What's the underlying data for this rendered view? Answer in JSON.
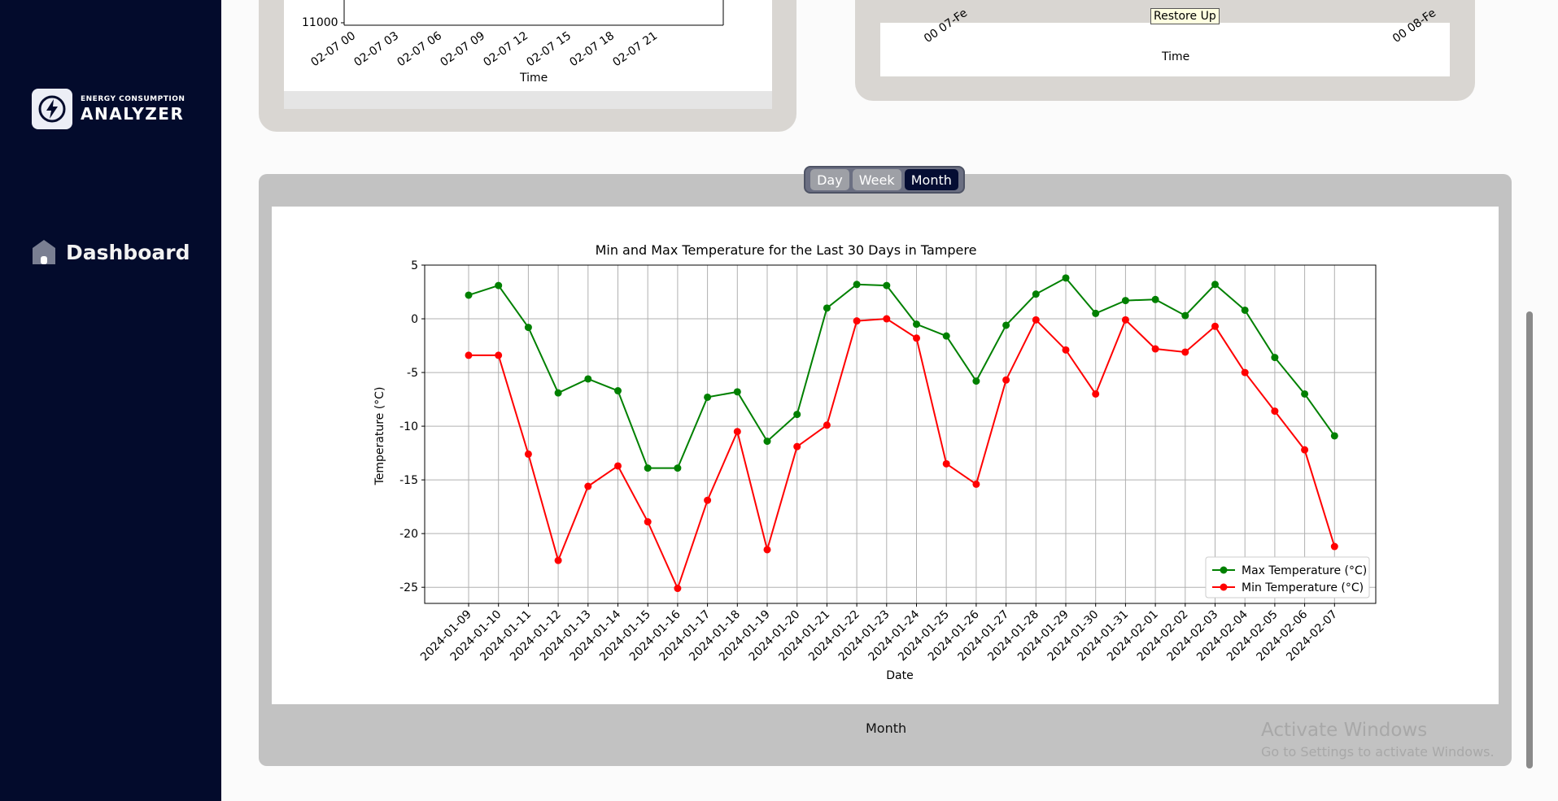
{
  "sidebar": {
    "logo_small": "ENERGY CONSUMPTION",
    "logo_big": "ANALYZER",
    "nav_items": [
      {
        "label": "Dashboard"
      }
    ]
  },
  "top_left_chart": {
    "y_tick": "11000",
    "x_ticks": [
      "02-07 00",
      "02-07 03",
      "02-07 06",
      "02-07 09",
      "02-07 12",
      "02-07 15",
      "02-07 18",
      "02-07 21"
    ],
    "xlabel": "Time"
  },
  "top_right_chart": {
    "xlabel": "Time",
    "tick_left": "07-Fe",
    "tick_left_top": "00",
    "tick_right": "08-Fe",
    "tick_right_top": "00"
  },
  "tooltip": "Restore Up",
  "range_selector": {
    "options": [
      "Day",
      "Week",
      "Month"
    ],
    "selected": "Month"
  },
  "footer_label": "Month",
  "watermark": {
    "line1": "Activate Windows",
    "line2": "Go to Settings to activate Windows."
  },
  "colors": {
    "max": "#008000",
    "min": "#ff0000",
    "sidebar": "#030b2c"
  },
  "chart_data": {
    "type": "line",
    "title": "Min and Max Temperature for the Last 30 Days in Tampere",
    "xlabel": "Date",
    "ylabel": "Temperature (°C)",
    "ylim": [
      -26.5,
      5
    ],
    "yticks": [
      5,
      0,
      -5,
      -10,
      -15,
      -20,
      -25
    ],
    "grid": true,
    "legend": "lower-right",
    "x": [
      "2024-01-09",
      "2024-01-10",
      "2024-01-11",
      "2024-01-12",
      "2024-01-13",
      "2024-01-14",
      "2024-01-15",
      "2024-01-16",
      "2024-01-17",
      "2024-01-18",
      "2024-01-19",
      "2024-01-20",
      "2024-01-21",
      "2024-01-22",
      "2024-01-23",
      "2024-01-24",
      "2024-01-25",
      "2024-01-26",
      "2024-01-27",
      "2024-01-28",
      "2024-01-29",
      "2024-01-30",
      "2024-01-31",
      "2024-02-01",
      "2024-02-02",
      "2024-02-03",
      "2024-02-04",
      "2024-02-05",
      "2024-02-06",
      "2024-02-07"
    ],
    "series": [
      {
        "name": "Max Temperature (°C)",
        "color": "#008000",
        "values": [
          2.2,
          3.1,
          -0.8,
          -6.9,
          -5.6,
          -6.7,
          -13.9,
          -13.9,
          -7.3,
          -6.8,
          -11.4,
          -8.9,
          1.0,
          3.2,
          3.1,
          -0.5,
          -1.6,
          -5.8,
          -0.6,
          2.3,
          3.8,
          0.5,
          1.7,
          1.8,
          0.3,
          3.2,
          0.8,
          -3.6,
          -7.0,
          -10.9
        ]
      },
      {
        "name": "Min Temperature (°C)",
        "color": "#ff0000",
        "values": [
          -3.4,
          -3.4,
          -12.6,
          -22.5,
          -15.6,
          -13.7,
          -18.9,
          -25.1,
          -16.9,
          -10.5,
          -21.5,
          -11.9,
          -9.9,
          -0.2,
          0.0,
          -1.8,
          -13.5,
          -15.4,
          -5.7,
          -0.1,
          -2.9,
          -7.0,
          -0.1,
          -2.8,
          -3.1,
          -0.7,
          -5.0,
          -8.6,
          -12.2,
          -21.2
        ]
      }
    ]
  }
}
